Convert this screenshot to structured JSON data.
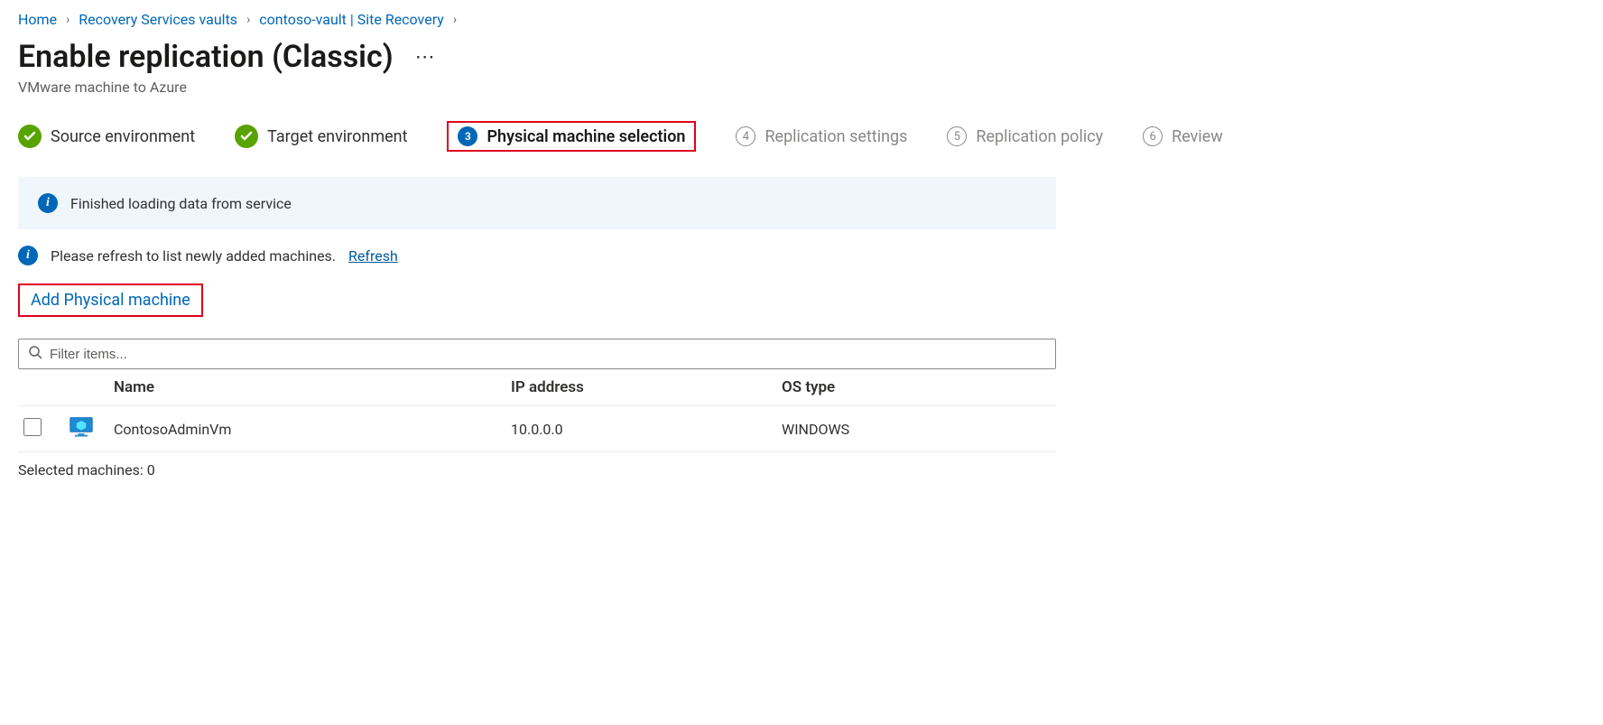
{
  "breadcrumb": {
    "home": "Home",
    "vaults": "Recovery Services vaults",
    "vault": "contoso-vault | Site Recovery"
  },
  "title": "Enable replication (Classic)",
  "subtitle": "VMware machine to Azure",
  "steps": {
    "s1": "Source environment",
    "s2": "Target environment",
    "s3": "Physical machine selection",
    "s4": "Replication settings",
    "s5": "Replication policy",
    "s6": "Review"
  },
  "banner": "Finished loading data from service",
  "refresh": {
    "text": "Please refresh to list newly added machines.",
    "link": "Refresh"
  },
  "add_machine": "Add Physical machine",
  "filter_placeholder": "Filter items...",
  "columns": {
    "name": "Name",
    "ip": "IP address",
    "os": "OS type"
  },
  "machines": [
    {
      "name": "ContosoAdminVm",
      "ip": "10.0.0.0",
      "os": "WINDOWS"
    }
  ],
  "selected_label": "Selected machines:",
  "selected_count": "0"
}
